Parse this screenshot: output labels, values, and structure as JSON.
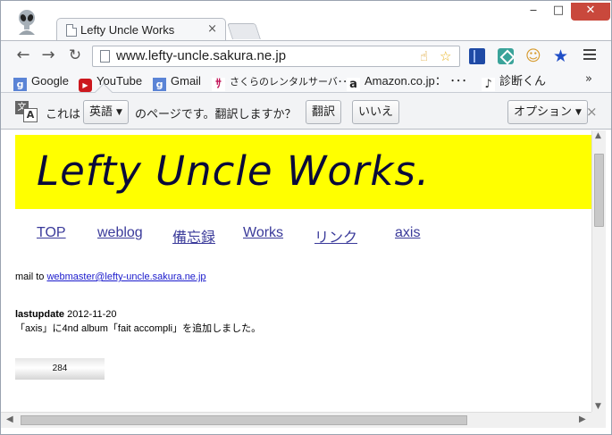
{
  "tab": {
    "title": "Lefty Uncle Works",
    "close_glyph": "×"
  },
  "window_controls": {
    "minimize": "‒",
    "maximize": "□",
    "close": "✕"
  },
  "toolbar": {
    "back": "←",
    "forward": "→",
    "reload": "↻",
    "url": "www.lefty-uncle.sakura.ne.jp"
  },
  "bookmarks": [
    {
      "label": "Google",
      "icon": "google-icon",
      "glyph": "g"
    },
    {
      "label": "YouTube",
      "icon": "youtube-icon",
      "glyph": "▶"
    },
    {
      "label": "Gmail",
      "icon": "gmail-icon",
      "glyph": "g"
    },
    {
      "label": "さくらのレンタルサーバ･･･",
      "icon": "sakura-icon",
      "glyph": "ｻ"
    },
    {
      "label": "Amazon.co.jp：  ･･･",
      "icon": "amazon-icon",
      "glyph": "a"
    },
    {
      "label": "診断くん",
      "icon": "shindan-icon",
      "glyph": "♪"
    }
  ],
  "bookmarks_more": "»",
  "infobar": {
    "prefix": "これは",
    "language": "英語",
    "suffix": "のページです。翻訳しますか？",
    "translate_button": "翻訳",
    "no_button": "いいえ",
    "options_button": "オプション",
    "close_glyph": "×",
    "icon_glyph_a": "文",
    "icon_glyph_b": "A"
  },
  "page": {
    "banner_title": "Lefty Uncle Works.",
    "nav": [
      "TOP",
      "weblog",
      "備忘録",
      "Works",
      "リンク",
      "axis"
    ],
    "mail_prefix": "mail to ",
    "mail_address": "webmaster@lefty-uncle.sakura.ne.jp",
    "lastupdate_label": "lastupdate",
    "lastupdate_date": " 2012-11-20",
    "update_message": "「axis」に4nd album「fait accompli」を追加しました。",
    "counter": "284"
  },
  "colors": {
    "banner": "#ffff00",
    "link": "#3a3a9a",
    "close_red": "#c9483c"
  }
}
